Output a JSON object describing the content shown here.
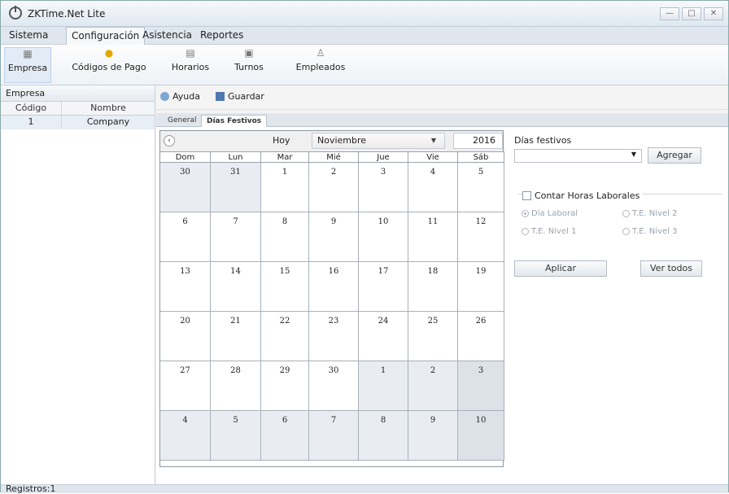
{
  "window": {
    "title": "ZKTime.Net Lite",
    "controls": [
      "—",
      "□",
      "✕"
    ]
  },
  "menu": [
    "Sistema",
    "Configuración",
    "Asistencia",
    "Reportes"
  ],
  "ribbon": [
    {
      "label": "Empresa",
      "icon": "building-icon"
    },
    {
      "label": "Códigos de Pago",
      "icon": "coin-icon"
    },
    {
      "label": "Horarios",
      "icon": "calendar-icon"
    },
    {
      "label": "Turnos",
      "icon": "schedule-icon"
    },
    {
      "label": "Empleados",
      "icon": "employee-icon"
    }
  ],
  "left": {
    "title": "Empresa",
    "columns": [
      "Código",
      "Nombre"
    ],
    "rows": [
      [
        "1",
        "Company"
      ]
    ]
  },
  "toolbar": {
    "help": "Ayuda",
    "save": "Guardar"
  },
  "tabs": [
    "General",
    "Días Festivos"
  ],
  "calendar": {
    "today": "Hoy",
    "month": "Noviembre",
    "year": "2016",
    "dows": [
      "Dom",
      "Lun",
      "Mar",
      "Mié",
      "Jue",
      "Vie",
      "Sáb"
    ],
    "weeks": [
      [
        "30",
        "31",
        "1",
        "2",
        "3",
        "4",
        "5"
      ],
      [
        "6",
        "7",
        "8",
        "9",
        "10",
        "11",
        "12"
      ],
      [
        "13",
        "14",
        "15",
        "16",
        "17",
        "18",
        "19"
      ],
      [
        "20",
        "21",
        "22",
        "23",
        "24",
        "25",
        "26"
      ],
      [
        "27",
        "28",
        "29",
        "30",
        "1",
        "2",
        "3"
      ],
      [
        "4",
        "5",
        "6",
        "7",
        "8",
        "9",
        "10"
      ]
    ]
  },
  "holidays": {
    "label": "Días festivos",
    "add": "Agregar",
    "count_label": "Contar Horas Laborales",
    "radios": [
      "Día Laboral",
      "T.E. Nivel 2",
      "T.E. Nivel 1",
      "T.E. Nivel 3"
    ],
    "apply": "Aplicar",
    "view_all": "Ver todos"
  },
  "status": "Registros:1"
}
